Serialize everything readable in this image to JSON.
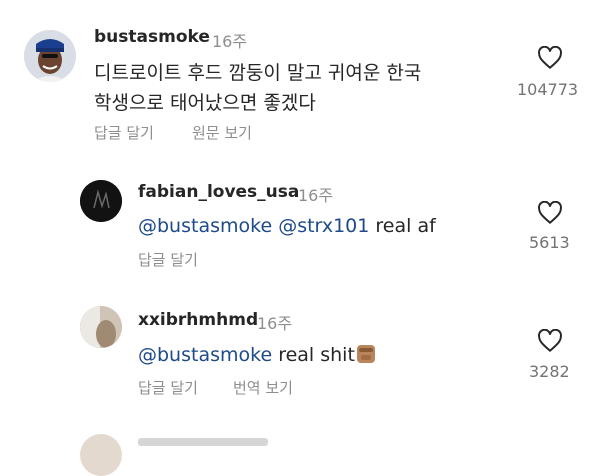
{
  "comments": [
    {
      "username": "bustasmoke",
      "time": "16주",
      "text_line1": "디트로이트 후드 깜둥이 말고 귀여운 한국",
      "text_line2": "학생으로 태어났으면 좋겠다",
      "reply_label": "답글 달기",
      "translate_label": "원문 보기",
      "likes": "104773",
      "icon": "heart-outline-icon"
    },
    {
      "username": "fabian_loves_usa",
      "time": "16주",
      "mention1": "@bustasmoke",
      "mention2": "@strx101",
      "text_rest": " real af",
      "reply_label": "답글 달기",
      "likes": "5613",
      "icon": "heart-outline-icon"
    },
    {
      "username": "xxibrhmhmd",
      "time": "16주",
      "mention1": "@bustasmoke",
      "text_rest": " real shit",
      "emoji": "raised-fist-emoji",
      "reply_label": "답글 달기",
      "translate_label": "번역 보기",
      "likes": "3282",
      "icon": "heart-outline-icon"
    }
  ],
  "colors": {
    "text": "#262626",
    "secondary": "#8e8e8e",
    "mention": "#1e4a8a"
  }
}
